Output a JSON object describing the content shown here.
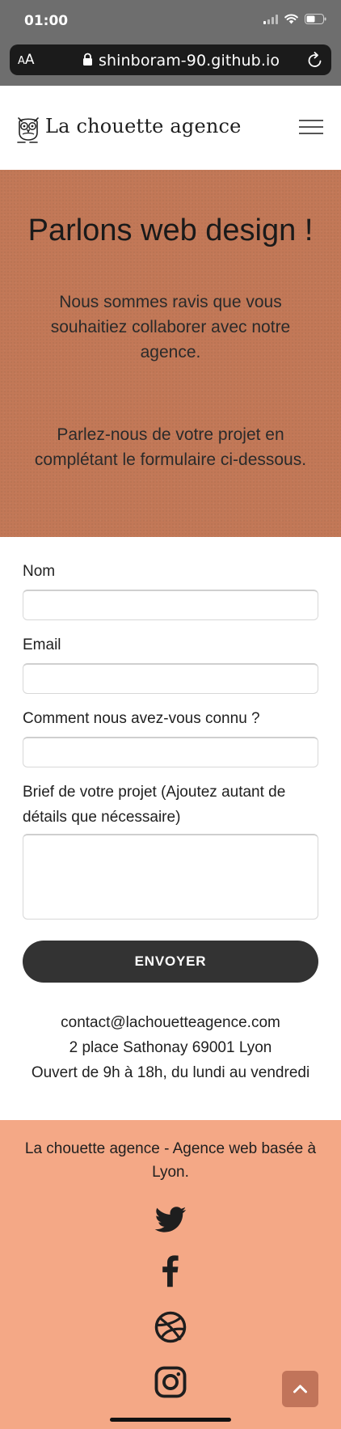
{
  "status_bar": {
    "time": "01:00"
  },
  "url_bar": {
    "aa_small": "A",
    "aa_big": "A",
    "url": "shinboram-90.github.io"
  },
  "header": {
    "brand": "La chouette agence"
  },
  "hero": {
    "title": "Parlons web design !",
    "paragraph_1": "Nous sommes ravis que vous souhaitiez collaborer avec notre agence.",
    "paragraph_2": "Parlez-nous de votre projet en complétant le formulaire ci-dessous."
  },
  "form": {
    "name_label": "Nom",
    "email_label": "Email",
    "source_label": "Comment nous avez-vous connu ?",
    "brief_label": "Brief de votre projet (Ajoutez autant de détails que nécessaire)",
    "name_value": "",
    "email_value": "",
    "source_value": "",
    "brief_value": "",
    "submit_label": "ENVOYER"
  },
  "contact": {
    "email": "contact@lachouetteagence.com",
    "address": "2 place Sathonay 69001 Lyon",
    "hours": "Ouvert de 9h à 18h, du lundi au vendredi"
  },
  "footer": {
    "tagline": "La chouette agence - Agence web basée à Lyon.",
    "social": [
      "twitter-icon",
      "facebook-icon",
      "dribbble-icon",
      "instagram-icon"
    ]
  },
  "colors": {
    "hero_bg": "#c27857",
    "footer_bg": "#f4a886",
    "button_bg": "#333333",
    "scroll_top_bg": "#c1745a",
    "chrome_bg": "#6e6e6e"
  }
}
